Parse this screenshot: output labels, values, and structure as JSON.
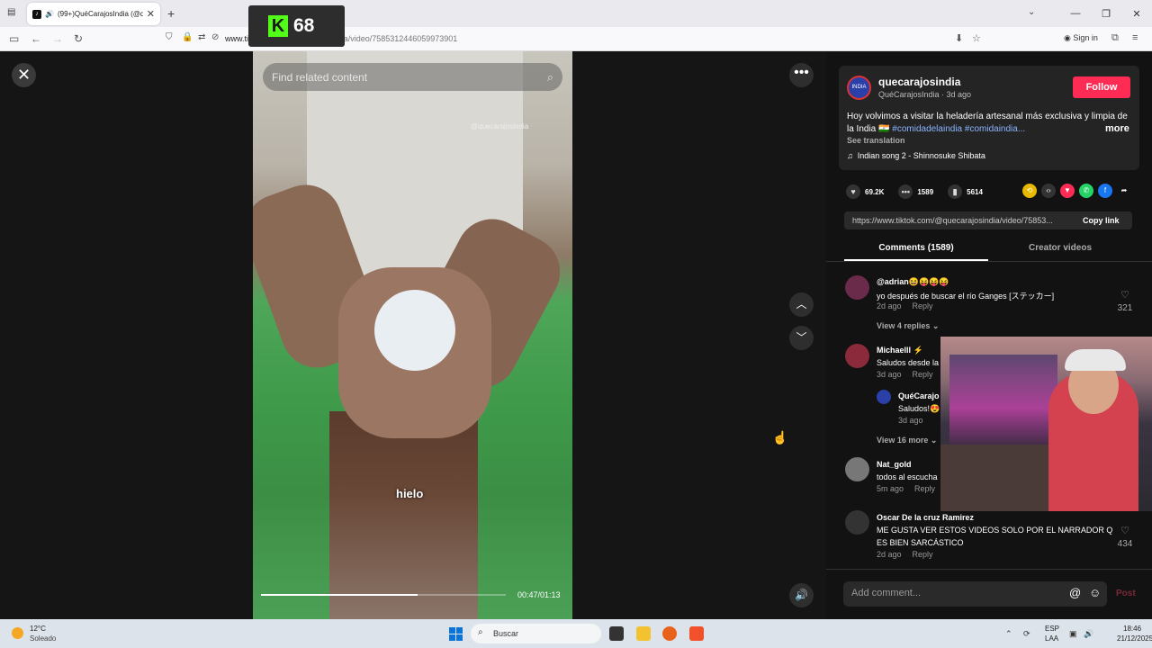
{
  "browser": {
    "tab_title": "(99+)QuéCarajosIndia (@q",
    "url_domain": "www.tiktok.com",
    "url_path": "/@quecarajosindia/video/7585312446059973901",
    "signin_label": "Sign in"
  },
  "overlay": {
    "score": "68",
    "logo_letter": "K"
  },
  "video": {
    "search_placeholder": "Find related content",
    "watermark": "@quecarajosindia",
    "caption": "hielo",
    "time": "00:47/01:13",
    "progress": 0.64
  },
  "post": {
    "username": "quecarajosindia",
    "subline": "QuéCarajosIndia · 3d ago",
    "follow_label": "Follow",
    "description_text": "Hoy volvimos a visitar la heladería artesanal más exclusiva y limpia de la India 🇮🇳 ",
    "tag1": "#comidadelaindia",
    "tag2": "#comidaindia...",
    "more_label": "more",
    "see_translation": "See translation",
    "song": "Indian song 2 - Shinnosuke Shibata",
    "likes": "69.2K",
    "comments_count": "1589",
    "saves": "5614",
    "link": "https://www.tiktok.com/@quecarajosindia/video/75853...",
    "copy_link_label": "Copy link",
    "tab_comments": "Comments (1589)",
    "tab_creator": "Creator videos"
  },
  "comments": [
    {
      "name": "@adrian😆😝😝😝",
      "text": "yo después de buscar el río Ganges [ステッカー]",
      "time": "2d ago",
      "reply": "Reply",
      "likes": "321",
      "views": "View 4 replies ⌄"
    },
    {
      "name": "Michaelll ⚡",
      "text": "Saludos desde la",
      "time": "3d ago",
      "reply": "Reply",
      "views": "View 16 more ⌄"
    },
    {
      "name": "QuéCarajo",
      "text": "Saludos!😍",
      "time": "3d ago"
    },
    {
      "name": "Nat_gold",
      "text": "todos al escucha",
      "time": "5m ago",
      "reply": "Reply"
    },
    {
      "name": "Oscar De la cruz Ramirez",
      "text": "ME GUSTA VER ESTOS VIDEOS SOLO POR EL NARRADOR Q",
      "text2": "ES BIEN SARCÁSTICO",
      "time": "2d ago",
      "reply": "Reply",
      "likes": "434"
    }
  ],
  "add_comment": {
    "placeholder": "Add comment...",
    "post_label": "Post"
  },
  "taskbar": {
    "temp": "12°C",
    "weather": "Soleado",
    "search": "Buscar",
    "lang1": "ESP",
    "lang2": "LAA",
    "time": "18:46",
    "date": "21/12/2025"
  },
  "colors": {
    "accent": "#fe2c55",
    "kick_green": "#53fc18",
    "hashtag": "#8ab4ff"
  },
  "icons": [
    "close-icon",
    "search-icon",
    "more-icon",
    "chevron-up-icon",
    "chevron-down-icon",
    "volume-icon",
    "heart-icon",
    "comment-icon",
    "bookmark-icon",
    "music-note-icon",
    "at-icon",
    "emoji-icon"
  ]
}
